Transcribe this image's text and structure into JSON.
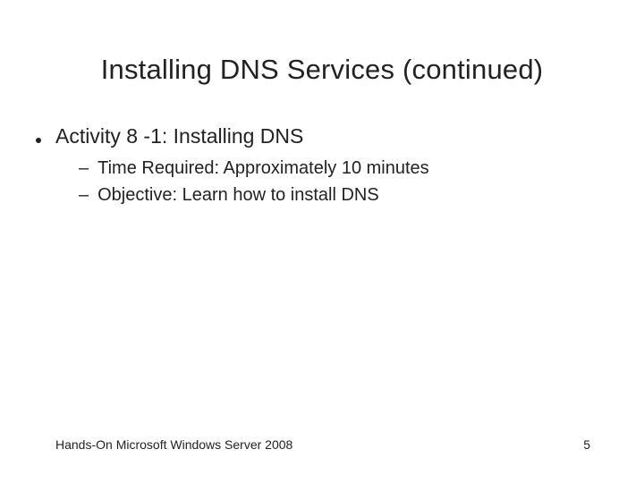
{
  "slide": {
    "title": "Installing DNS Services (continued)",
    "bullets": [
      {
        "text": "Activity 8 -1: Installing DNS",
        "subs": [
          "Time Required: Approximately 10 minutes",
          "Objective: Learn how to install DNS"
        ]
      }
    ],
    "footer_left": "Hands-On Microsoft Windows Server 2008",
    "page_number": "5"
  }
}
